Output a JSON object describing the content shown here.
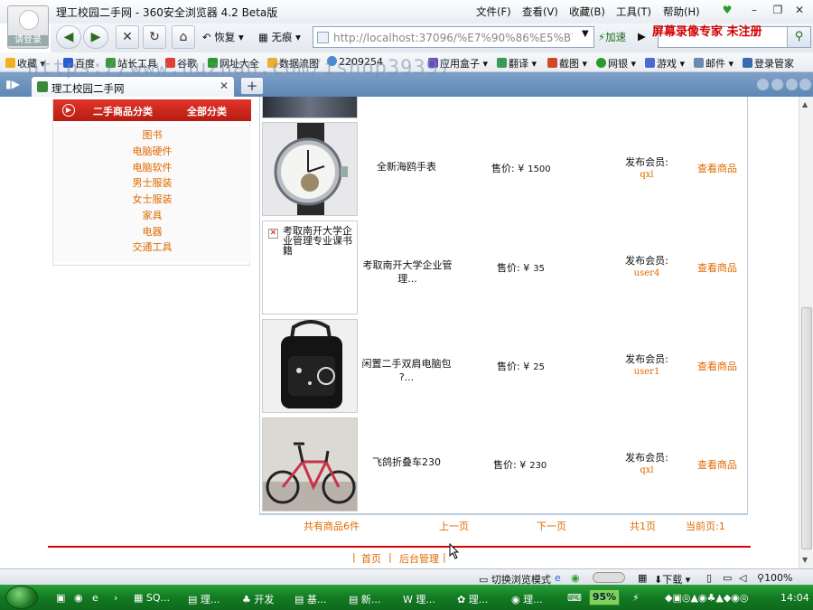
{
  "browser": {
    "window_title": "理工校园二手网 - 360安全浏览器 4.2 Beta版",
    "menus": [
      "文件(F)",
      "查看(V)",
      "收藏(B)",
      "工具(T)",
      "帮助(H)"
    ],
    "brand_overlay": "屏幕录像专家 未注册",
    "avatar_label": "请登录",
    "restore_label": "恢复",
    "incognito_label": "无痕",
    "address": "http://localhost:37096/%E7%90%86%E5%B7",
    "accelerate_label": "加速",
    "bookmarks": [
      "收藏",
      "百度",
      "站长工具",
      "谷歌",
      "网址大全",
      "数据流图",
      "2209254",
      "应用盒子",
      "翻译",
      "截图",
      "网银",
      "游戏",
      "邮件",
      "登录管家"
    ],
    "tab_title": "理工校园二手网",
    "watermark": "https://www.huzhan.com/ishop39397"
  },
  "categories": {
    "header_left": "二手商品分类",
    "header_right": "全部分类",
    "items": [
      "图书",
      "电脑硬件",
      "电脑软件",
      "男士服装",
      "女士服装",
      "家具",
      "电器",
      "交通工具"
    ]
  },
  "products": [
    {
      "name": "全新海鸥手表",
      "price_label": "售价: ¥",
      "price": "1500",
      "member_label": "发布会员:",
      "member": "qxl",
      "view_label": "查看商品"
    },
    {
      "name": "考取南开大学企业管理...",
      "broken_image_alt": "考取南开大学企业管理专业课书籍",
      "price_label": "售价: ¥",
      "price": "35",
      "member_label": "发布会员:",
      "member": "user4",
      "view_label": "查看商品"
    },
    {
      "name": "闲置二手双肩电脑包 ?...",
      "price_label": "售价: ¥",
      "price": "25",
      "member_label": "发布会员:",
      "member": "user1",
      "view_label": "查看商品"
    },
    {
      "name": "飞鸽折叠车230",
      "price_label": "售价: ¥",
      "price": "230",
      "member_label": "发布会员:",
      "member": "qxl",
      "view_label": "查看商品"
    }
  ],
  "pager": {
    "total": "共有商品6件",
    "prev": "上一页",
    "next": "下一页",
    "pages": "共1页",
    "current": "当前页:1"
  },
  "footer": {
    "sep1": "|",
    "home": "首页",
    "sep2": "|",
    "admin": "后台管理",
    "sep3": "|"
  },
  "statusbar": {
    "mode": "切换浏览模式",
    "download": "下载",
    "zoom": "100%"
  },
  "taskbar": {
    "items": [
      "SQ...",
      "理...",
      "开发",
      "基...",
      "新...",
      "理...",
      "理...",
      "理..."
    ],
    "cpu": "95%",
    "clock": "14:04"
  },
  "colors": {
    "accent_orange": "#e06a00",
    "header_red": "#c8261b",
    "divider_red": "#e00000"
  }
}
